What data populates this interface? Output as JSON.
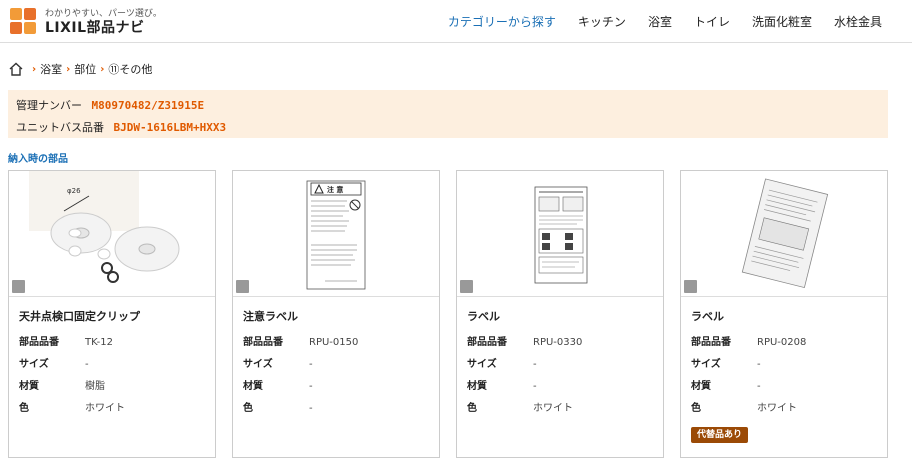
{
  "header": {
    "tagline": "わかりやすい、パーツ選び。",
    "brand": "LIXIL部品ナビ",
    "nav": [
      {
        "label": "カテゴリーから探す",
        "active": true
      },
      {
        "label": "キッチン",
        "active": false
      },
      {
        "label": "浴室",
        "active": false
      },
      {
        "label": "トイレ",
        "active": false
      },
      {
        "label": "洗面化粧室",
        "active": false
      },
      {
        "label": "水栓金具",
        "active": false
      }
    ]
  },
  "breadcrumb": [
    "浴室",
    "部位",
    "⑪その他"
  ],
  "info": {
    "mgmt_label": "管理ナンバー",
    "mgmt_value": "M80970482/Z31915E",
    "unit_label": "ユニットバス品番",
    "unit_value": "BJDW-1616LBM+HXX3"
  },
  "section_title": "納入時の部品",
  "spec_labels": {
    "part_no": "部品品番",
    "size": "サイズ",
    "material": "材質",
    "color": "色"
  },
  "products": [
    {
      "name": "天井点検口固定クリップ",
      "part_no": "TK-12",
      "size": "-",
      "material": "樹脂",
      "color": "ホワイト",
      "badge": "",
      "image_label": "φ26"
    },
    {
      "name": "注意ラベル",
      "part_no": "RPU-0150",
      "size": "-",
      "material": "-",
      "color": "-",
      "badge": "",
      "image_label": "注 意"
    },
    {
      "name": "ラベル",
      "part_no": "RPU-0330",
      "size": "-",
      "material": "-",
      "color": "ホワイト",
      "badge": "",
      "image_label": ""
    },
    {
      "name": "ラベル",
      "part_no": "RPU-0208",
      "size": "-",
      "material": "-",
      "color": "ホワイト",
      "badge": "代替品あり",
      "image_label": ""
    }
  ],
  "colors": {
    "accent_orange": "#e05a00",
    "link_blue": "#1a6fb5",
    "info_bg": "#fdefdf",
    "badge_brown": "#9b4a06"
  }
}
